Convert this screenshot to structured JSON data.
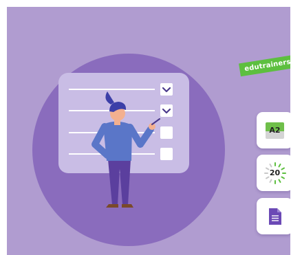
{
  "brand": {
    "label": "edutrainers",
    "color": "#5dbf3f"
  },
  "colors": {
    "background": "#b09cd0",
    "circle": "#8a6cbd",
    "board": "#c9bde5",
    "accent": "#6b49b5"
  },
  "side_buttons": [
    {
      "icon": "level-badge-icon",
      "label": "A2"
    },
    {
      "icon": "timer-icon",
      "label": "20"
    },
    {
      "icon": "document-icon",
      "label": ""
    }
  ]
}
